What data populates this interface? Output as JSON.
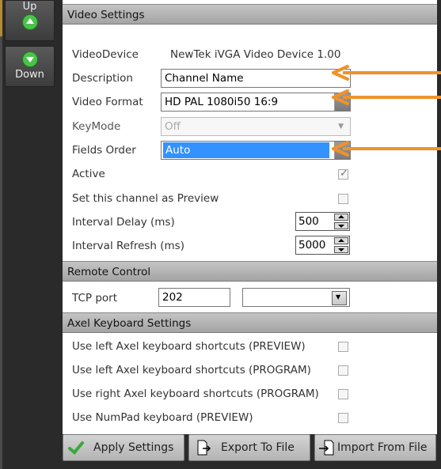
{
  "sidebar": {
    "up_label": "Up",
    "down_label": "Down"
  },
  "sections": {
    "video_settings": "Video Settings",
    "remote_control": "Remote Control",
    "axel_keyboard": "Axel Keyboard Settings"
  },
  "video": {
    "device_label": "VideoDevice",
    "device_value": "NewTek iVGA Video Device 1.00",
    "description_label": "Description",
    "description_value": "Channel Name",
    "format_label": "Video Format",
    "format_value": "HD PAL 1080i50 16:9",
    "keymode_label": "KeyMode",
    "keymode_value": "Off",
    "fields_order_label": "Fields Order",
    "fields_order_value": "Auto",
    "active_label": "Active",
    "active_checked": true,
    "preview_label": "Set this channel as Preview",
    "preview_checked": false,
    "interval_delay_label": "Interval Delay (ms)",
    "interval_delay_value": "500",
    "interval_refresh_label": "Interval Refresh (ms)",
    "interval_refresh_value": "5000"
  },
  "remote": {
    "tcp_label": "TCP port",
    "tcp_value": "202",
    "tcp_select_value": ""
  },
  "axel": {
    "left_preview_label": "Use left Axel keyboard shortcuts (PREVIEW)",
    "left_program_label": "Use left Axel keyboard shortcuts (PROGRAM)",
    "right_program_label": "Use right Axel keyboard shortcuts (PROGRAM)",
    "numpad_preview_label": "Use NumPad keyboard (PREVIEW)"
  },
  "buttons": {
    "apply": "Apply Settings",
    "export": "Export To File",
    "import": "Import From File"
  },
  "colors": {
    "arrow": "#f0922a",
    "selection": "#3392ff",
    "green_icon": "#4cc24c"
  }
}
